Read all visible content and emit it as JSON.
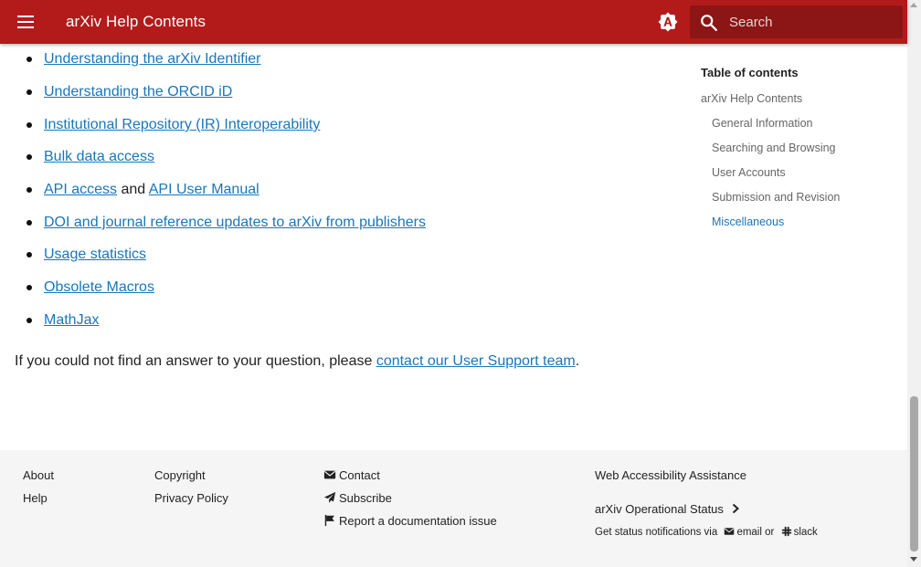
{
  "header": {
    "menu_icon": "hamburger-menu-icon",
    "title": "arXiv Help Contents",
    "theme_icon": "theme-toggle-icon",
    "search_placeholder": "Search",
    "search_icon": "search-icon",
    "brand_color": "#b31b1b"
  },
  "content": {
    "links": [
      {
        "parts": [
          "Understanding the arXiv Identifier"
        ]
      },
      {
        "parts": [
          "Understanding the ORCID iD"
        ]
      },
      {
        "parts": [
          "Institutional Repository (IR) Interoperability"
        ]
      },
      {
        "parts": [
          "Bulk data access"
        ]
      },
      {
        "parts": [
          "API access",
          " and ",
          "API User Manual"
        ]
      },
      {
        "parts": [
          "DOI and journal reference updates to arXiv from publishers"
        ]
      },
      {
        "parts": [
          "Usage statistics"
        ]
      },
      {
        "parts": [
          "Obsolete Macros"
        ]
      },
      {
        "parts": [
          "MathJax"
        ]
      }
    ],
    "support_prefix": "If you could not find an answer to your question, please ",
    "support_link": "contact our User Support team",
    "support_suffix": "."
  },
  "toc": {
    "title": "Table of contents",
    "items": [
      {
        "label": "arXiv Help Contents",
        "active": false
      },
      {
        "label": "General Information",
        "active": false
      },
      {
        "label": "Searching and Browsing",
        "active": false
      },
      {
        "label": "User Accounts",
        "active": false
      },
      {
        "label": "Submission and Revision",
        "active": false
      },
      {
        "label": "Miscellaneous",
        "active": true
      }
    ]
  },
  "footer": {
    "about": "About",
    "help": "Help",
    "copyright": "Copyright",
    "privacy": "Privacy Policy",
    "contact": "Contact",
    "subscribe": "Subscribe",
    "report": "Report a documentation issue",
    "accessibility": "Web Accessibility Assistance",
    "status": "arXiv Operational Status",
    "notify_prefix": "Get status notifications via",
    "notify_email": "email",
    "notify_or": "or",
    "notify_slack": "slack"
  }
}
